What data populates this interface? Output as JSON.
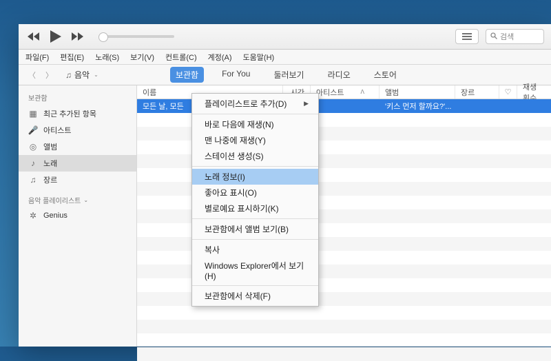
{
  "toolbar": {
    "search_placeholder": "검색"
  },
  "menubar": [
    "파일(F)",
    "편집(E)",
    "노래(S)",
    "보기(V)",
    "컨트롤(C)",
    "계정(A)",
    "도움말(H)"
  ],
  "nav": {
    "selector_label": "음악",
    "tabs": [
      "보관함",
      "For You",
      "둘러보기",
      "라디오",
      "스토어"
    ],
    "active_tab": 0
  },
  "sidebar": {
    "header1": "보관함",
    "items1": [
      {
        "icon": "grid",
        "label": "최근 추가된 항목"
      },
      {
        "icon": "mic",
        "label": "아티스트"
      },
      {
        "icon": "album",
        "label": "앨범"
      },
      {
        "icon": "note",
        "label": "노래",
        "selected": true
      },
      {
        "icon": "eq",
        "label": "장르"
      }
    ],
    "header2": "음악 플레이리스트",
    "items2": [
      {
        "icon": "genius",
        "label": "Genius"
      }
    ]
  },
  "columns": {
    "name": "이름",
    "time": "시간",
    "artist": "아티스트",
    "album": "앨범",
    "genre": "장르",
    "plays": "재생 횟수"
  },
  "rows": [
    {
      "name": "모든 날, 모든",
      "artist": "",
      "album": "'키스 먼저 할까요?'..."
    }
  ],
  "context_menu": [
    {
      "label": "플레이리스트로 추가(D)",
      "submenu": true
    },
    {
      "sep": true
    },
    {
      "label": "바로 다음에 재생(N)"
    },
    {
      "label": "맨 나중에 재생(Y)"
    },
    {
      "label": "스테이션 생성(S)"
    },
    {
      "sep": true
    },
    {
      "label": "노래 정보(I)",
      "highlight": true
    },
    {
      "label": "좋아요 표시(O)"
    },
    {
      "label": "별로예요 표시하기(K)"
    },
    {
      "sep": true
    },
    {
      "label": "보관함에서 앨범 보기(B)"
    },
    {
      "sep": true
    },
    {
      "label": "복사"
    },
    {
      "label": "Windows Explorer에서 보기(H)"
    },
    {
      "sep": true
    },
    {
      "label": "보관함에서 삭제(F)"
    }
  ]
}
